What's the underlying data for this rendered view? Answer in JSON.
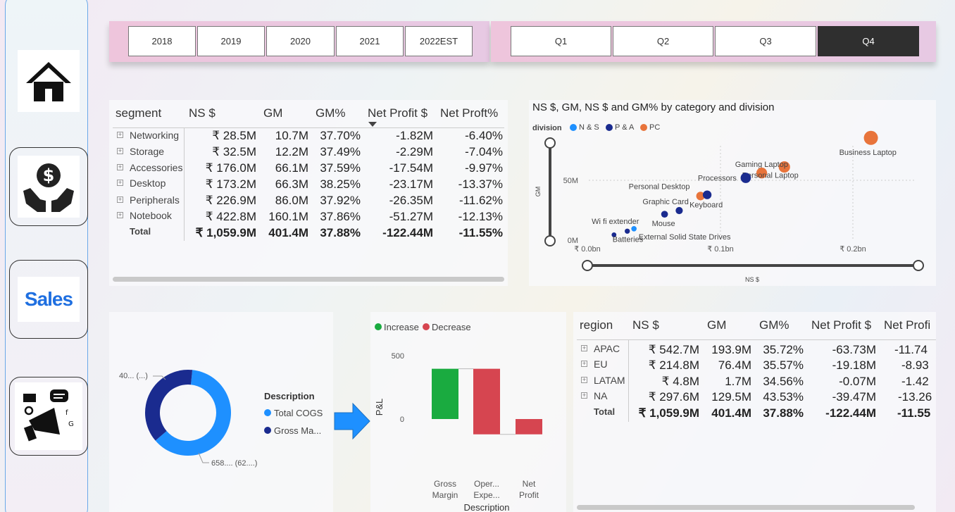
{
  "years": [
    "2018",
    "2019",
    "2020",
    "2021",
    "2022EST"
  ],
  "quarters": [
    "Q1",
    "Q2",
    "Q3",
    "Q4"
  ],
  "active_quarter": "Q4",
  "nav": {
    "home_icon": "house-icon",
    "finance_icon": "money-hands-icon",
    "sales_logo": "Sales",
    "marketing_icon": "megaphone-icon"
  },
  "segment_table": {
    "headers": [
      "segment",
      "NS $",
      "GM",
      "GM%",
      "Net Profit $",
      "Net Proft%"
    ],
    "rows": [
      {
        "label": "Networking",
        "ns": "₹ 28.5M",
        "gm": "10.7M",
        "gmp": "37.70%",
        "np": "-1.82M",
        "npp": "-6.40%"
      },
      {
        "label": "Storage",
        "ns": "₹ 32.5M",
        "gm": "12.2M",
        "gmp": "37.49%",
        "np": "-2.29M",
        "npp": "-7.04%"
      },
      {
        "label": "Accessories",
        "ns": "₹ 176.0M",
        "gm": "66.1M",
        "gmp": "37.59%",
        "np": "-17.54M",
        "npp": "-9.97%"
      },
      {
        "label": "Desktop",
        "ns": "₹ 173.2M",
        "gm": "66.3M",
        "gmp": "38.25%",
        "np": "-23.17M",
        "npp": "-13.37%"
      },
      {
        "label": "Peripherals",
        "ns": "₹ 226.9M",
        "gm": "86.0M",
        "gmp": "37.92%",
        "np": "-26.35M",
        "npp": "-11.62%"
      },
      {
        "label": "Notebook",
        "ns": "₹ 422.8M",
        "gm": "160.1M",
        "gmp": "37.86%",
        "np": "-51.27M",
        "npp": "-12.13%"
      }
    ],
    "total": {
      "label": "Total",
      "ns": "₹ 1,059.9M",
      "gm": "401.4M",
      "gmp": "37.88%",
      "np": "-122.44M",
      "npp": "-11.55%"
    }
  },
  "region_table": {
    "headers": [
      "region",
      "NS $",
      "GM",
      "GM%",
      "Net Profit $",
      "Net Profi"
    ],
    "rows": [
      {
        "label": "APAC",
        "ns": "₹ 542.7M",
        "gm": "193.9M",
        "gmp": "35.72%",
        "np": "-63.73M",
        "npp": "-11.74"
      },
      {
        "label": "EU",
        "ns": "₹ 214.8M",
        "gm": "76.4M",
        "gmp": "35.57%",
        "np": "-19.18M",
        "npp": "-8.93"
      },
      {
        "label": "LATAM",
        "ns": "₹ 4.8M",
        "gm": "1.7M",
        "gmp": "34.56%",
        "np": "-0.07M",
        "npp": "-1.42"
      },
      {
        "label": "NA",
        "ns": "₹ 297.6M",
        "gm": "129.5M",
        "gmp": "43.53%",
        "np": "-39.47M",
        "npp": "-13.26"
      }
    ],
    "total": {
      "label": "Total",
      "ns": "₹ 1,059.9M",
      "gm": "401.4M",
      "gmp": "37.88%",
      "np": "-122.44M",
      "npp": "-11.55"
    }
  },
  "scatter": {
    "title": "NS $, GM, NS $ and GM% by category and division",
    "legend_title": "division",
    "divisions": [
      {
        "name": "N & S",
        "color": "#1e90ff"
      },
      {
        "name": "P & A",
        "color": "#1a2b8f"
      },
      {
        "name": "PC",
        "color": "#e8743b"
      }
    ],
    "y_ticks": [
      "50M",
      "0M"
    ],
    "x_ticks": [
      "₹ 0.0bn",
      "₹ 0.1bn",
      "₹ 0.2bn"
    ],
    "y_label": "GM",
    "x_label": "NS $"
  },
  "chart_data": [
    {
      "type": "scatter",
      "title": "NS $, GM, NS $ and GM% by category and division",
      "xlabel": "NS $",
      "ylabel": "GM",
      "xlim": [
        0,
        0.26
      ],
      "ylim": [
        0,
        90
      ],
      "points": [
        {
          "label": "Business Laptop",
          "x": 0.213,
          "y": 85,
          "division": "PC"
        },
        {
          "label": "Gaming Laptop",
          "x": 0.148,
          "y": 61,
          "division": "PC"
        },
        {
          "label": "Personal Laptop",
          "x": 0.131,
          "y": 56,
          "division": "PC"
        },
        {
          "label": "Processors",
          "x": 0.119,
          "y": 52,
          "division": "P & A"
        },
        {
          "label": "Personal Desktop",
          "x": 0.085,
          "y": 37,
          "division": "PC"
        },
        {
          "label": "Keyboard",
          "x": 0.09,
          "y": 38,
          "division": "P & A"
        },
        {
          "label": "Graphic Card",
          "x": 0.069,
          "y": 25,
          "division": "P & A"
        },
        {
          "label": "Mouse",
          "x": 0.058,
          "y": 22,
          "division": "P & A"
        },
        {
          "label": "Wi fi extender",
          "x": 0.035,
          "y": 10,
          "division": "N & S"
        },
        {
          "label": "External Solid State Drives",
          "x": 0.03,
          "y": 8,
          "division": "P & A"
        },
        {
          "label": "Batteries",
          "x": 0.02,
          "y": 5,
          "division": "P & A"
        }
      ]
    },
    {
      "type": "pie",
      "title": "",
      "legend_title": "Description",
      "slices": [
        {
          "label": "Total COGS",
          "value": 658,
          "color": "#1e90ff",
          "data_label": "658.... (62....)"
        },
        {
          "label": "Gross Ma...",
          "value": 401,
          "color": "#1a2b8f",
          "data_label": "40... (...)"
        }
      ]
    },
    {
      "type": "bar",
      "title": "",
      "xlabel": "Description",
      "ylabel": "P&L",
      "ylim": [
        -200,
        600
      ],
      "y_ticks": [
        "500",
        "0"
      ],
      "categories": [
        "Gross Margin",
        "Oper... Expe...",
        "Net Profit"
      ],
      "category_lines": [
        [
          "Gross",
          "Margin"
        ],
        [
          "Oper...",
          "Expe..."
        ],
        [
          "Net",
          "Profit"
        ]
      ],
      "legend": [
        {
          "name": "Increase",
          "color": "#1aab40"
        },
        {
          "name": "Decrease",
          "color": "#d64550"
        }
      ],
      "steps": [
        {
          "start": 0,
          "end": 401,
          "kind": "Increase"
        },
        {
          "start": 401,
          "end": -122,
          "kind": "Decrease"
        },
        {
          "start": -122,
          "end": -122,
          "kind": "Decrease",
          "total": true
        }
      ]
    }
  ]
}
